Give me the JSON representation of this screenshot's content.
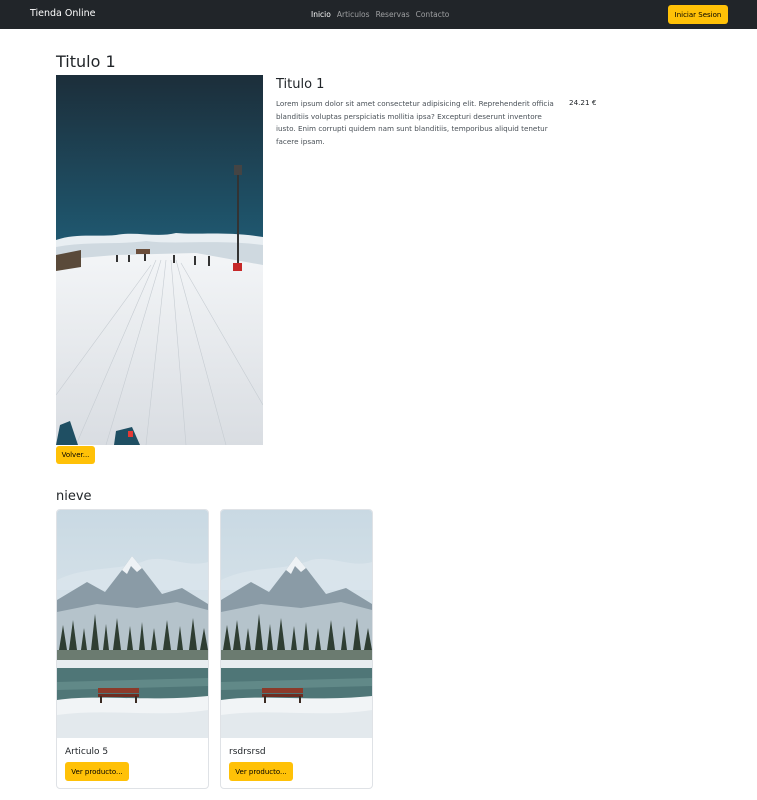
{
  "navbar": {
    "brand": "Tienda Online",
    "links": [
      {
        "label": "Inicio",
        "active": true
      },
      {
        "label": "Articulos",
        "active": false
      },
      {
        "label": "Reservas",
        "active": false
      },
      {
        "label": "Contacto",
        "active": false
      }
    ],
    "login_label": "Iniciar Sesion"
  },
  "page": {
    "title": "Titulo 1"
  },
  "product": {
    "title": "Titulo 1",
    "description": "Lorem ipsum dolor sit amet consectetur adipisicing elit. Reprehenderit officia blanditiis voluptas perspiciatis mollitia ipsa? Excepturi deserunt inventore iusto. Enim corrupti quidem nam sunt blanditiis, temporibus aliquid tenetur facere ipsam.",
    "price": "24.21 €",
    "back_label": "Volver..."
  },
  "section": {
    "title": "nieve",
    "cards": [
      {
        "title": "Articulo 5",
        "button_label": "Ver producto..."
      },
      {
        "title": "rsdrsrsd",
        "button_label": "Ver producto..."
      }
    ]
  },
  "colors": {
    "navbar_bg": "#212529",
    "accent": "#ffc107"
  }
}
